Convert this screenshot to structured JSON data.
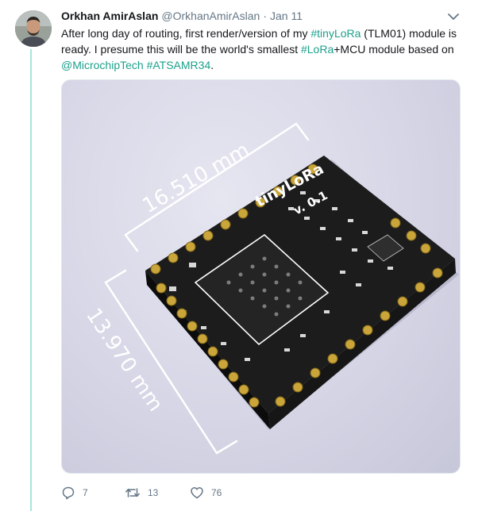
{
  "tweet": {
    "display_name": "Orkhan AmirAslan",
    "handle": "@OrkhanAmirAslan",
    "separator": "·",
    "time": "Jan 11",
    "text_parts": [
      "After long day of routing, first render/version of my ",
      "#tinyLoRa",
      " (TLM01) module is",
      "ready. I presume this will be the world's smallest ",
      "#LoRa",
      "+MCU module based on",
      "@MicrochipTech",
      " ",
      "#ATSAMR34",
      "."
    ],
    "icons": {
      "avatar": "avatar",
      "caret": "chevron-down-icon",
      "reply": "reply-icon",
      "retweet": "retweet-icon",
      "like": "heart-icon"
    },
    "colors": {
      "link": "#1ca08b",
      "thread": "#a6e6d8",
      "muted": "#657786"
    }
  },
  "media": {
    "board_label": "tinyLoRa",
    "version_label": "v. 0.1",
    "width_dimension": "16.510 mm",
    "height_dimension": "13.970 mm"
  },
  "actions": {
    "reply_count": "7",
    "retweet_count": "13",
    "like_count": "76"
  }
}
